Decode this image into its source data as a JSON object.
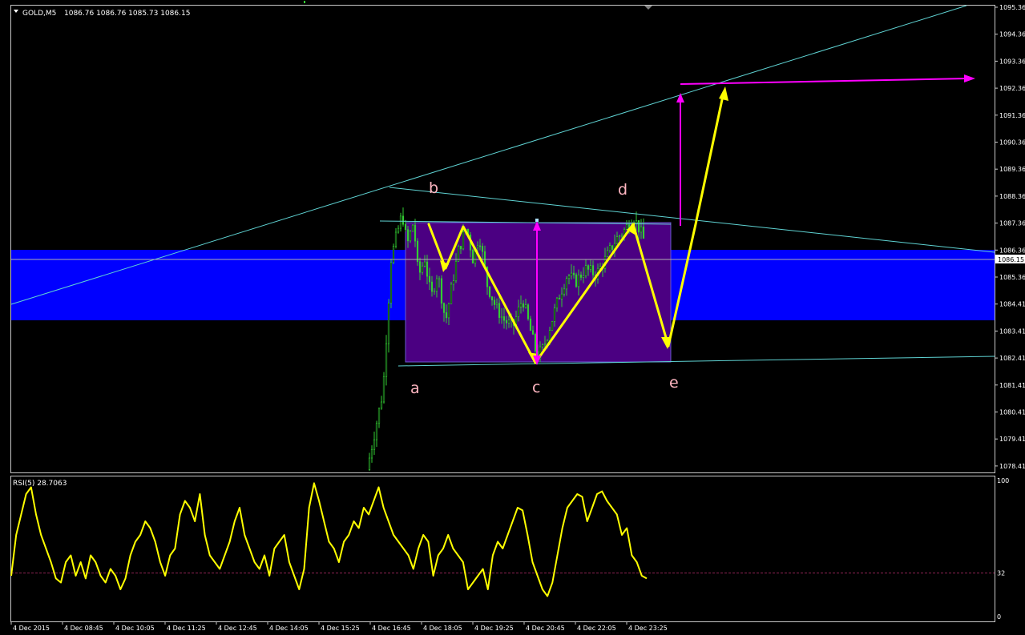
{
  "window": {
    "symbol_header": "GOLD,M5",
    "ohlc": "1086.76 1086.76 1085.73 1086.15",
    "menu_icon": "triangle-down-icon"
  },
  "colors": {
    "background": "#000000",
    "frame": "#c8c8c8",
    "candle": "#32cd32",
    "box_fill": "#4b0082",
    "zone_fill": "#0000ff",
    "trendline": "#5fd3d3",
    "wave_arrow": "#ffff00",
    "target_arrow": "#ff00ff",
    "label": "#ffb6c1",
    "rsi_line": "#ffff00",
    "rsi_level": "#8b2252",
    "price_marker_bg": "#ffffff"
  },
  "chart_data": [
    {
      "type": "candlestick",
      "title": "GOLD,M5",
      "ylim": [
        1077.9,
        1095.6
      ],
      "y_ticks": [
        "1095.36",
        "1094.36",
        "1093.36",
        "1092.36",
        "1091.36",
        "1090.36",
        "1089.36",
        "1088.36",
        "1087.36",
        "1086.36",
        "1085.36",
        "1084.41",
        "1083.41",
        "1082.41",
        "1081.41",
        "1080.41",
        "1079.41",
        "1078.41"
      ],
      "current_price": "1086.15",
      "x_ticks": [
        "4 Dec 2015",
        "4 Dec 08:45",
        "4 Dec 10:05",
        "4 Dec 11:25",
        "4 Dec 12:45",
        "4 Dec 14:05",
        "4 Dec 15:25",
        "4 Dec 16:45",
        "4 Dec 18:05",
        "4 Dec 19:25",
        "4 Dec 20:45",
        "4 Dec 22:05",
        "4 Dec 23:25"
      ],
      "price_path": [
        [
          0.0,
          1078.0
        ],
        [
          0.5,
          1079.5
        ],
        [
          1.0,
          1081.0
        ],
        [
          1.25,
          1083.5
        ],
        [
          1.5,
          1086.0
        ],
        [
          1.9,
          1087.0
        ],
        [
          2.2,
          1087.7
        ],
        [
          2.5,
          1086.5
        ],
        [
          2.9,
          1087.4
        ],
        [
          3.2,
          1085.3
        ],
        [
          3.6,
          1086.0
        ],
        [
          4.0,
          1084.5
        ],
        [
          4.4,
          1085.5
        ],
        [
          4.9,
          1083.6
        ],
        [
          5.3,
          1085.0
        ],
        [
          5.7,
          1086.3
        ],
        [
          6.2,
          1087.2
        ],
        [
          6.6,
          1086.0
        ],
        [
          7.0,
          1086.9
        ],
        [
          7.5,
          1085.0
        ],
        [
          8.0,
          1084.2
        ],
        [
          8.5,
          1083.7
        ],
        [
          9.1,
          1083.4
        ],
        [
          9.7,
          1084.5
        ],
        [
          10.1,
          1083.5
        ],
        [
          10.6,
          1082.3
        ],
        [
          11.0,
          1082.6
        ],
        [
          11.5,
          1083.6
        ],
        [
          12.0,
          1084.6
        ],
        [
          12.5,
          1085.4
        ],
        [
          13.0,
          1085.1
        ],
        [
          13.6,
          1085.6
        ],
        [
          14.3,
          1085.4
        ],
        [
          14.9,
          1086.0
        ],
        [
          15.5,
          1086.7
        ],
        [
          16.1,
          1087.1
        ],
        [
          16.6,
          1087.6
        ],
        [
          17.0,
          1087.1
        ],
        [
          17.4,
          1086.5
        ]
      ]
    },
    {
      "type": "line",
      "title": "RSI(5) 28.7063",
      "ylim": [
        0,
        100
      ],
      "y_ticks": [
        "100",
        "32",
        "0"
      ],
      "level": 32,
      "values": [
        30,
        60,
        75,
        90,
        95,
        75,
        60,
        50,
        40,
        28,
        25,
        40,
        45,
        30,
        40,
        28,
        45,
        40,
        30,
        25,
        35,
        30,
        20,
        28,
        45,
        55,
        60,
        70,
        65,
        55,
        40,
        30,
        45,
        50,
        75,
        85,
        80,
        70,
        90,
        60,
        45,
        40,
        35,
        45,
        55,
        70,
        80,
        60,
        50,
        40,
        35,
        45,
        30,
        50,
        55,
        60,
        40,
        30,
        20,
        35,
        80,
        98,
        85,
        70,
        55,
        50,
        40,
        55,
        60,
        70,
        65,
        80,
        75,
        85,
        95,
        80,
        70,
        60,
        55,
        50,
        45,
        35,
        50,
        60,
        55,
        30,
        45,
        50,
        60,
        50,
        45,
        40,
        20,
        25,
        30,
        35,
        20,
        45,
        55,
        50,
        60,
        70,
        80,
        78,
        60,
        40,
        30,
        20,
        15,
        25,
        45,
        65,
        80,
        85,
        90,
        88,
        70,
        80,
        90,
        92,
        85,
        80,
        75,
        60,
        65,
        45,
        40,
        30,
        28
      ]
    }
  ],
  "wave_labels": [
    "a",
    "b",
    "c",
    "d",
    "e"
  ]
}
